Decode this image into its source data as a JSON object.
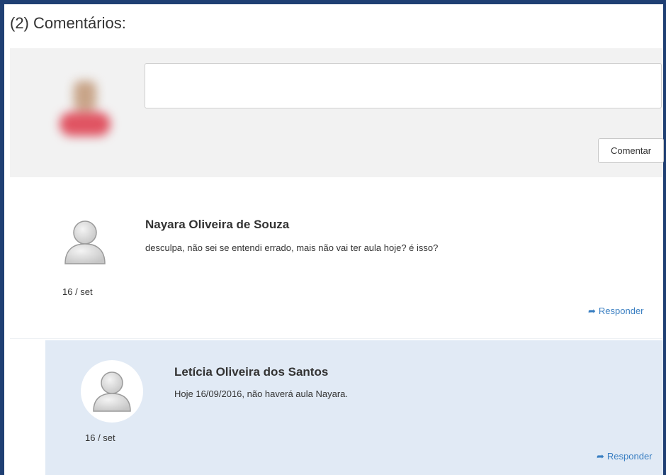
{
  "section": {
    "title": "(2) Comentários:"
  },
  "compose": {
    "placeholder": "",
    "button_label": "Comentar"
  },
  "comments": [
    {
      "author": "Nayara Oliveira de Souza",
      "text": "desculpa, não sei se entendi errado, mais não vai ter aula hoje? é isso?",
      "date": "16 / set",
      "reply_label": "Responder",
      "avatar": "default-user-icon"
    },
    {
      "author": "Letícia Oliveira dos Santos",
      "text": "Hoje 16/09/2016, não haverá aula Nayara.",
      "date": "16 / set",
      "reply_label": "Responder",
      "avatar": "default-user-icon",
      "is_reply": true
    }
  ],
  "colors": {
    "frame": "#1f3f73",
    "link": "#3a7fc2",
    "reply_background": "#e1eaf5",
    "compose_background": "#f2f2f2"
  }
}
